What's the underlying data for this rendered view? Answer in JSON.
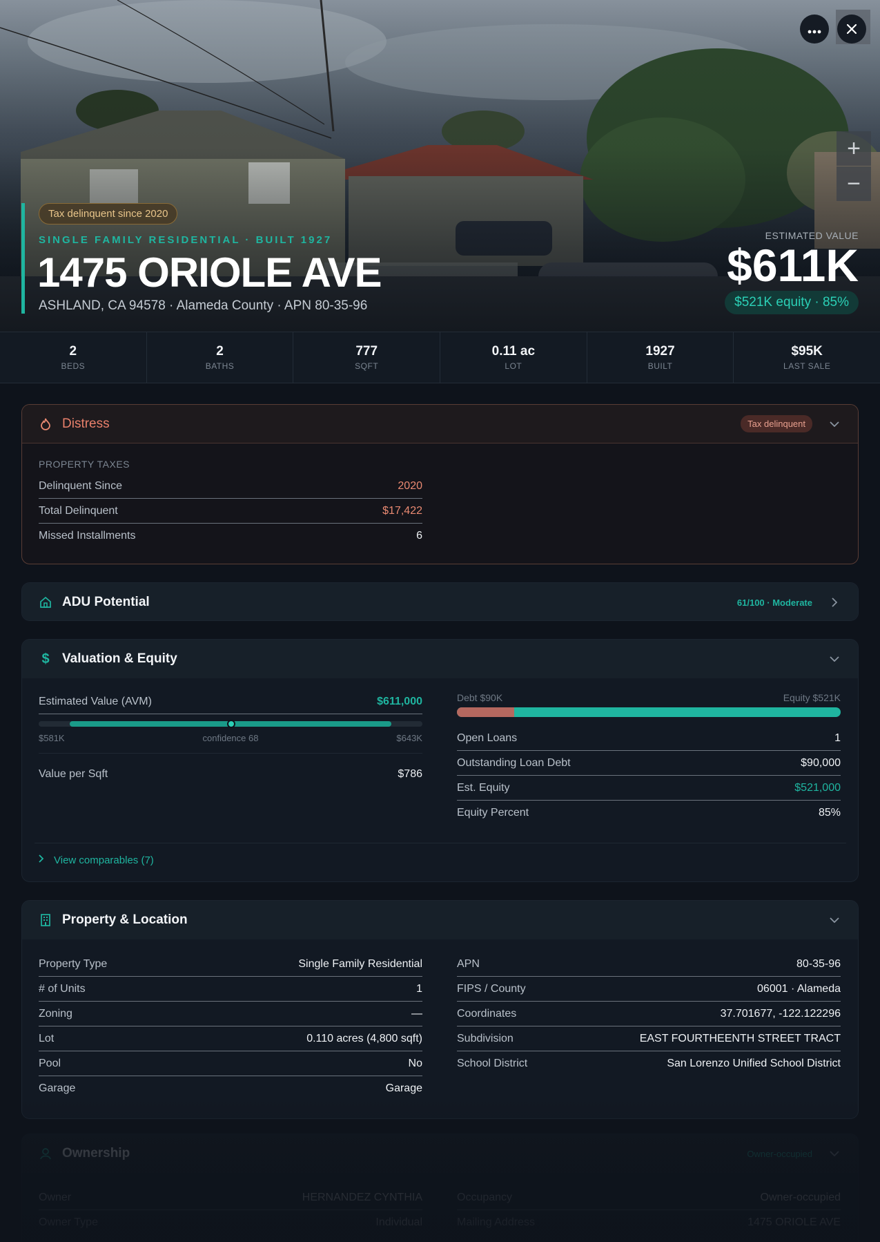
{
  "hero": {
    "tax_badge": "Tax delinquent since 2020",
    "subtype": "SINGLE FAMILY RESIDENTIAL · BUILT 1927",
    "address": "1475 ORIOLE AVE",
    "location": "ASHLAND, CA 94578 · Alameda County · APN 80-35-96",
    "est_label": "ESTIMATED VALUE",
    "est_value": "$611K",
    "equity_badge": "$521K equity · 85%",
    "zoom_in": "+",
    "zoom_out": "−",
    "icons": {
      "more": "more-horizontal-icon",
      "close": "close-icon"
    }
  },
  "stats": [
    {
      "value": "2",
      "label": "BEDS"
    },
    {
      "value": "2",
      "label": "BATHS"
    },
    {
      "value": "777",
      "label": "SQFT"
    },
    {
      "value": "0.11 ac",
      "label": "LOT"
    },
    {
      "value": "1927",
      "label": "BUILT"
    },
    {
      "value": "$95K",
      "label": "LAST SALE"
    }
  ],
  "distress": {
    "title": "Distress",
    "badge": "Tax delinquent",
    "section_label": "PROPERTY TAXES",
    "rows": [
      {
        "label": "Delinquent Since",
        "value": "2020"
      },
      {
        "label": "Total Delinquent",
        "value": "$17,422"
      },
      {
        "label": "Missed Installments",
        "value": "6"
      }
    ]
  },
  "adu": {
    "title": "ADU Potential",
    "badge": "61/100 · Moderate"
  },
  "valuation": {
    "title": "Valuation & Equity",
    "avm_label": "Estimated Value (AVM)",
    "avm_value": "$611,000",
    "avm_low": "$581K",
    "avm_confidence": "confidence 68",
    "avm_high": "$643K",
    "per_sqft_label": "Value per Sqft",
    "per_sqft_value": "$786",
    "debt_label": "Debt $90K",
    "equity_label": "Equity $521K",
    "equity_fraction": 0.85,
    "rows": [
      {
        "label": "Open Loans",
        "value": "1"
      },
      {
        "label": "Outstanding Loan Debt",
        "value": "$90,000"
      },
      {
        "label": "Est. Equity",
        "value": "$521,000"
      },
      {
        "label": "Equity Percent",
        "value": "85%"
      }
    ],
    "comparables_link": "View comparables (7)"
  },
  "property": {
    "title": "Property & Location",
    "left_rows": [
      {
        "label": "Property Type",
        "value": "Single Family Residential"
      },
      {
        "label": "# of Units",
        "value": "1"
      },
      {
        "label": "Zoning",
        "value": "—"
      },
      {
        "label": "Lot",
        "value": "0.110 acres (4,800 sqft)"
      },
      {
        "label": "Pool",
        "value": "No"
      },
      {
        "label": "Garage",
        "value": "Garage"
      }
    ],
    "right_rows": [
      {
        "label": "APN",
        "value": "80-35-96"
      },
      {
        "label": "FIPS / County",
        "value": "06001 · Alameda"
      },
      {
        "label": "Coordinates",
        "value": "37.701677, -122.122296"
      },
      {
        "label": "Subdivision",
        "value": "EAST FOURTHEENTH STREET TRACT"
      },
      {
        "label": "School District",
        "value": "San Lorenzo Unified School District"
      }
    ]
  },
  "ownership": {
    "title": "Ownership",
    "badge": "Owner-occupied",
    "left_rows": [
      {
        "label": "Owner",
        "value": "HERNANDEZ CYNTHIA"
      },
      {
        "label": "Owner Type",
        "value": "Individual"
      }
    ],
    "right_rows": [
      {
        "label": "Occupancy",
        "value": "Owner-occupied"
      },
      {
        "label": "Mailing Address",
        "value": "1475 ORIOLE AVE"
      }
    ]
  },
  "colors": {
    "accent": "#1fb5a0",
    "distress": "#ea8a72",
    "background": "#0e131b"
  }
}
